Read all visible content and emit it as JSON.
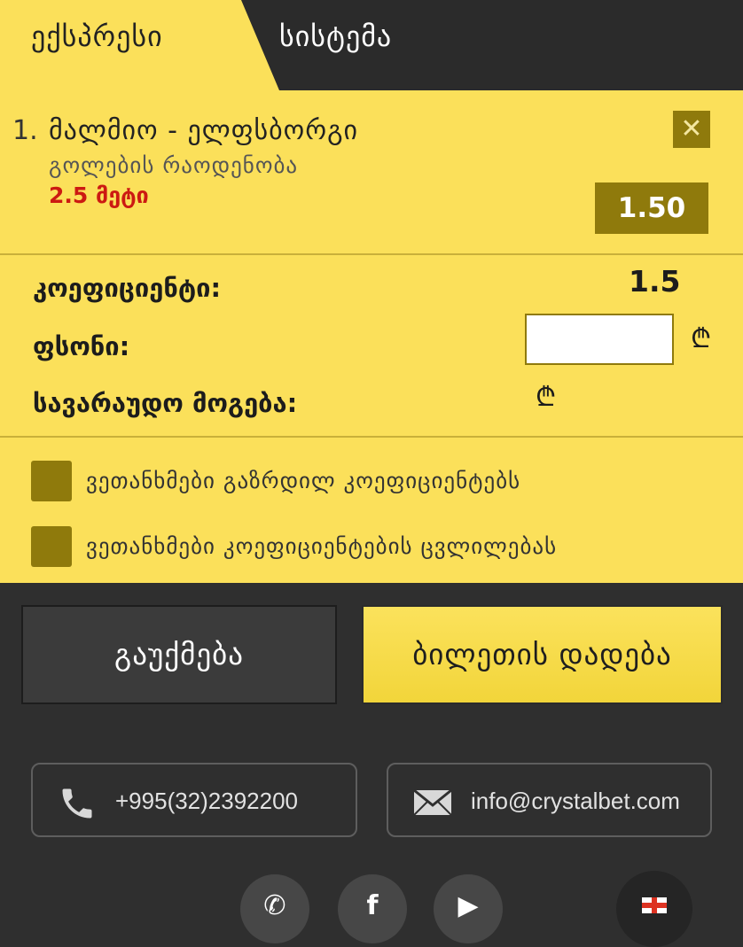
{
  "tabs": {
    "express": "ექსპრესი",
    "system": "სისტემა"
  },
  "bet": {
    "index": "1.",
    "match": "მალმიო - ელფსბორგი",
    "market": "გოლების რაოდენობა",
    "selection": "2.5 მეტი",
    "odd": "1.50",
    "close_symbol": "✕"
  },
  "summary": {
    "coef_label": "კოეფიციენტი:",
    "coef_value": "1.5",
    "stake_label": "ფსონი:",
    "stake_value": "",
    "currency": "₾",
    "win_label": "სავარაუდო მოგება:",
    "win_value": ""
  },
  "options": [
    {
      "label": "ვეთანხმები გაზრდილ კოეფიციენტებს",
      "checked": false
    },
    {
      "label": "ვეთანხმები კოეფიციენტების ცვლილებას",
      "checked": false
    }
  ],
  "buttons": {
    "cancel": "გაუქმება",
    "place": "ბილეთის დადება"
  },
  "contacts": {
    "phone": "+995(32)2392200",
    "email": "info@crystalbet.com"
  },
  "colors": {
    "accent": "#fbe05a",
    "dark": "#2f2f2f",
    "olive": "#8f7a0c",
    "selection_red": "#cc1a12"
  }
}
